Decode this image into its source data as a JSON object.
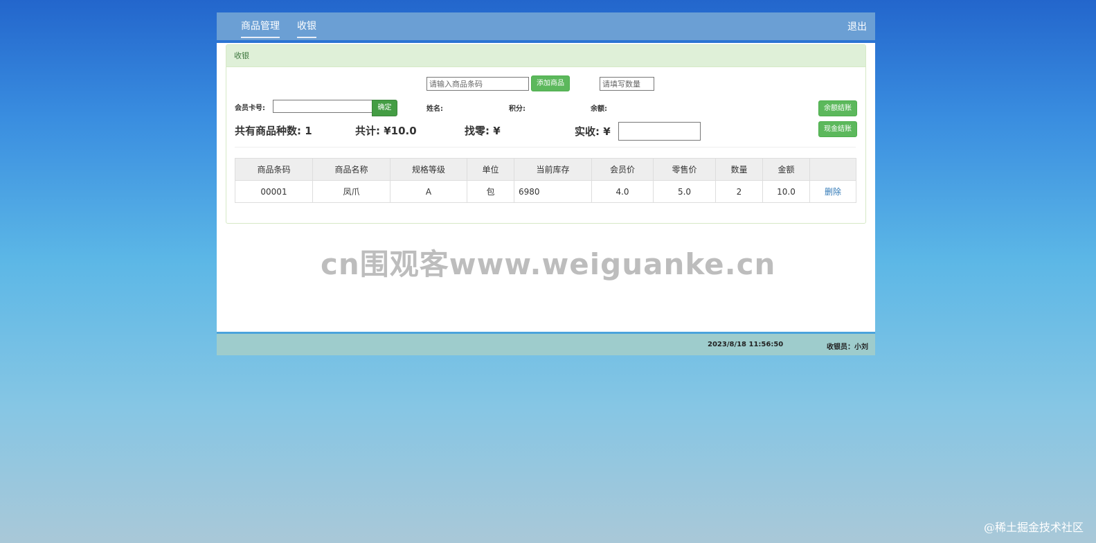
{
  "nav": {
    "items": [
      {
        "label": "商品管理"
      },
      {
        "label": "收银"
      }
    ],
    "logout": "退出"
  },
  "panel": {
    "title": "收银"
  },
  "barcode": {
    "placeholder": "请输入商品条码",
    "value": "",
    "add_button": "添加商品"
  },
  "quantity": {
    "placeholder": "请填写数量",
    "value": ""
  },
  "member": {
    "card_label": "会员卡号:",
    "card_value": "",
    "confirm_button": "确定",
    "name_label": "姓名:",
    "points_label": "积分:",
    "balance_label": "余额:"
  },
  "checkout": {
    "balance_button": "余额结账",
    "cash_button": "现金结账"
  },
  "summary": {
    "kinds_label": "共有商品种数:",
    "kinds_value": "1",
    "total_label": "共计:",
    "total_value": "¥10.0",
    "change_label": "找零:",
    "change_value": "¥",
    "received_label": "实收:",
    "received_currency": "¥",
    "received_value": ""
  },
  "table": {
    "columns": [
      "商品条码",
      "商品名称",
      "规格等级",
      "单位",
      "当前库存",
      "会员价",
      "零售价",
      "数量",
      "金额",
      ""
    ],
    "rows": [
      {
        "barcode": "00001",
        "name": "凤爪",
        "grade": "A",
        "unit": "包",
        "stock": "6980",
        "member_price": "4.0",
        "retail_price": "5.0",
        "qty": "2",
        "amount": "10.0",
        "action": "删除"
      }
    ]
  },
  "watermark": "cn围观客www.weiguanke.cn",
  "footer": {
    "datetime": "2023/8/18 11:56:50",
    "cashier": "收银员：小刘"
  },
  "corner_watermark": "@稀土掘金技术社区",
  "colors": {
    "nav_bg": "#6b9fd4",
    "panel_heading_bg": "#dff0d8",
    "button_green": "#5cb85c",
    "footer_bg": "#9ecccc",
    "link": "#337ab7"
  }
}
